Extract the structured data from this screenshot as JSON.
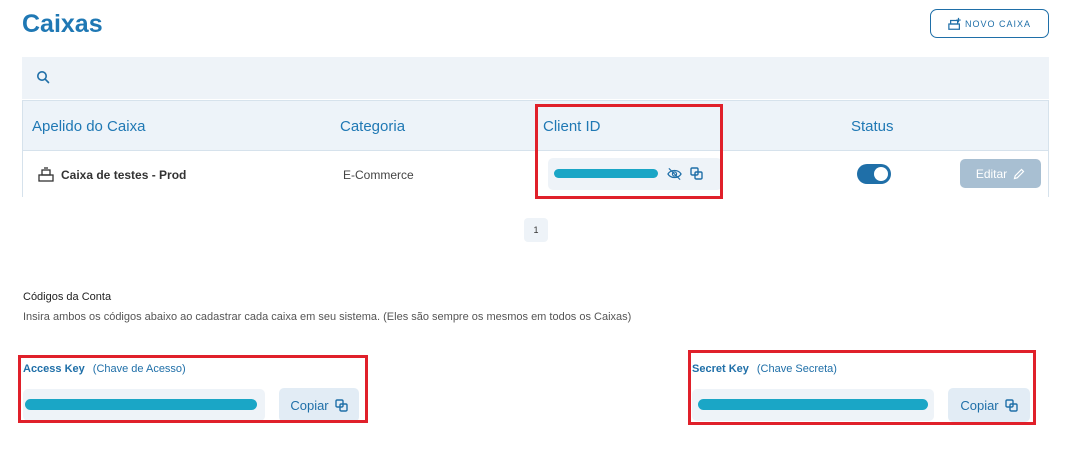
{
  "page": {
    "title": "Caixas"
  },
  "toolbar": {
    "new_label": "NOVO CAIXA"
  },
  "table": {
    "headers": {
      "name": "Apelido do Caixa",
      "category": "Categoria",
      "client_id": "Client ID",
      "status": "Status"
    },
    "rows": [
      {
        "name": "Caixa de testes - Prod",
        "category": "E-Commerce",
        "status_on": true,
        "edit_label": "Editar"
      }
    ]
  },
  "pagination": {
    "current": "1"
  },
  "codes": {
    "title": "Códigos da Conta",
    "description": "Insira ambos os códigos abaixo ao cadastrar cada caixa em seu sistema. (Eles são sempre os mesmos em todos os Caixas)",
    "access": {
      "label": "Access Key",
      "sub": "(Chave de Acesso)",
      "copy_label": "Copiar"
    },
    "secret": {
      "label": "Secret Key",
      "sub": "(Chave Secreta)",
      "copy_label": "Copiar"
    }
  },
  "colors": {
    "accent": "#1f78b4",
    "highlight": "#e0202a",
    "redaction": "#1aa6c6"
  }
}
